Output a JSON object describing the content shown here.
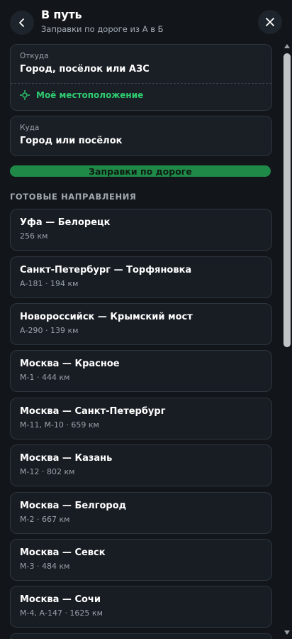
{
  "header": {
    "title": "В путь",
    "subtitle": "Заправки по дороге из А в Б",
    "back_icon": "chevron-left-icon",
    "close_icon": "close-icon"
  },
  "from_field": {
    "label": "Откуда",
    "placeholder": "Город, посёлок или АЗС",
    "my_location": "Моё местоположение"
  },
  "to_field": {
    "label": "Куда",
    "placeholder": "Город или посёлок"
  },
  "search_button": "Заправки по дороге",
  "section_title": "ГОТОВЫЕ НАПРАВЛЕНИЯ",
  "routes": [
    {
      "name": "Уфа — Белорецк",
      "meta": "256 км"
    },
    {
      "name": "Санкт-Петербург — Торфяновка",
      "meta": "А-181 · 194 км"
    },
    {
      "name": "Новороссийск — Крымский мост",
      "meta": "А-290 · 139 км"
    },
    {
      "name": "Москва — Красное",
      "meta": "М-1 · 444 км"
    },
    {
      "name": "Москва — Санкт-Петербург",
      "meta": "М-11, М-10 · 659 км"
    },
    {
      "name": "Москва — Казань",
      "meta": "М-12 · 802 км"
    },
    {
      "name": "Москва — Белгород",
      "meta": "М-2 · 667 км"
    },
    {
      "name": "Москва — Севск",
      "meta": "М-3 · 484 км"
    },
    {
      "name": "Москва — Сочи",
      "meta": "М-4, А-147 · 1625 км"
    }
  ],
  "colors": {
    "accent": "#2ecc71",
    "button": "#1f8a47",
    "background": "#12161b"
  }
}
